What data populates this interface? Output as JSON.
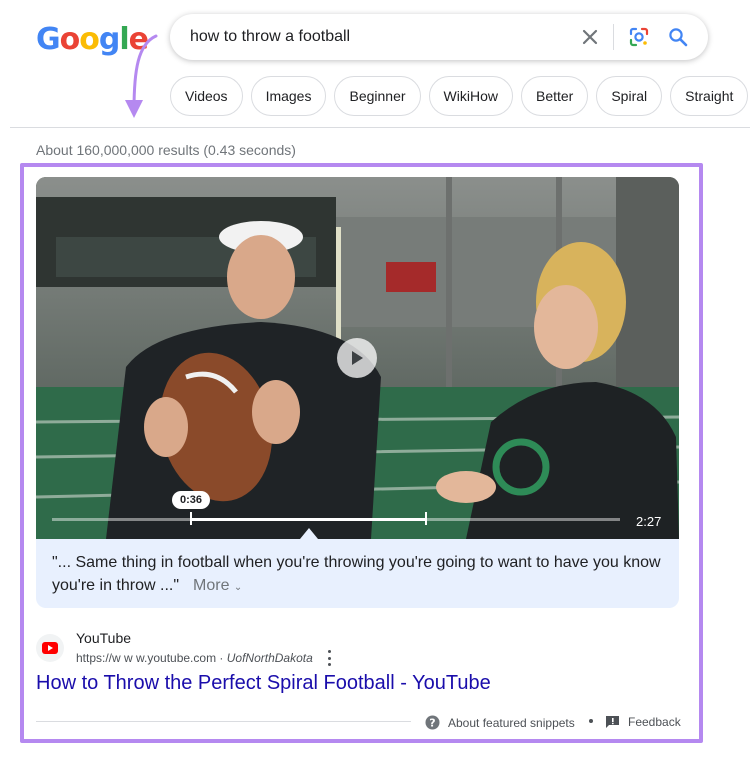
{
  "logo": {
    "letters": [
      "G",
      "o",
      "o",
      "g",
      "l",
      "e"
    ],
    "colors": [
      "#4285f4",
      "#ea4335",
      "#fbbc05",
      "#4285f4",
      "#34a853",
      "#ea4335"
    ]
  },
  "search": {
    "query": "how to throw a football",
    "icons": [
      "close-icon",
      "google-lens-icon",
      "search-icon"
    ]
  },
  "chips": [
    "Videos",
    "Images",
    "Beginner",
    "WikiHow",
    "Better",
    "Spiral",
    "Straight"
  ],
  "stats": "About 160,000,000 results (0.43 seconds)",
  "highlight_color": "#b589f0",
  "video": {
    "current_time": "0:36",
    "duration": "2:27",
    "progress_fraction": 0.245,
    "clip_end_fraction": 0.658,
    "transcript": "\"... Same thing in football when you're throwing you're going to want to have you know you're in throw ...\"",
    "more_label": "More"
  },
  "result": {
    "site_name": "YouTube",
    "url": "https://w w w.youtube.com",
    "url_sep": " · ",
    "channel": "UofNorthDakota",
    "title": "How to Throw the Perfect Spiral Football - YouTube",
    "title_color": "#1a0dab"
  },
  "footer": {
    "about": "About featured snippets",
    "feedback": "Feedback"
  }
}
